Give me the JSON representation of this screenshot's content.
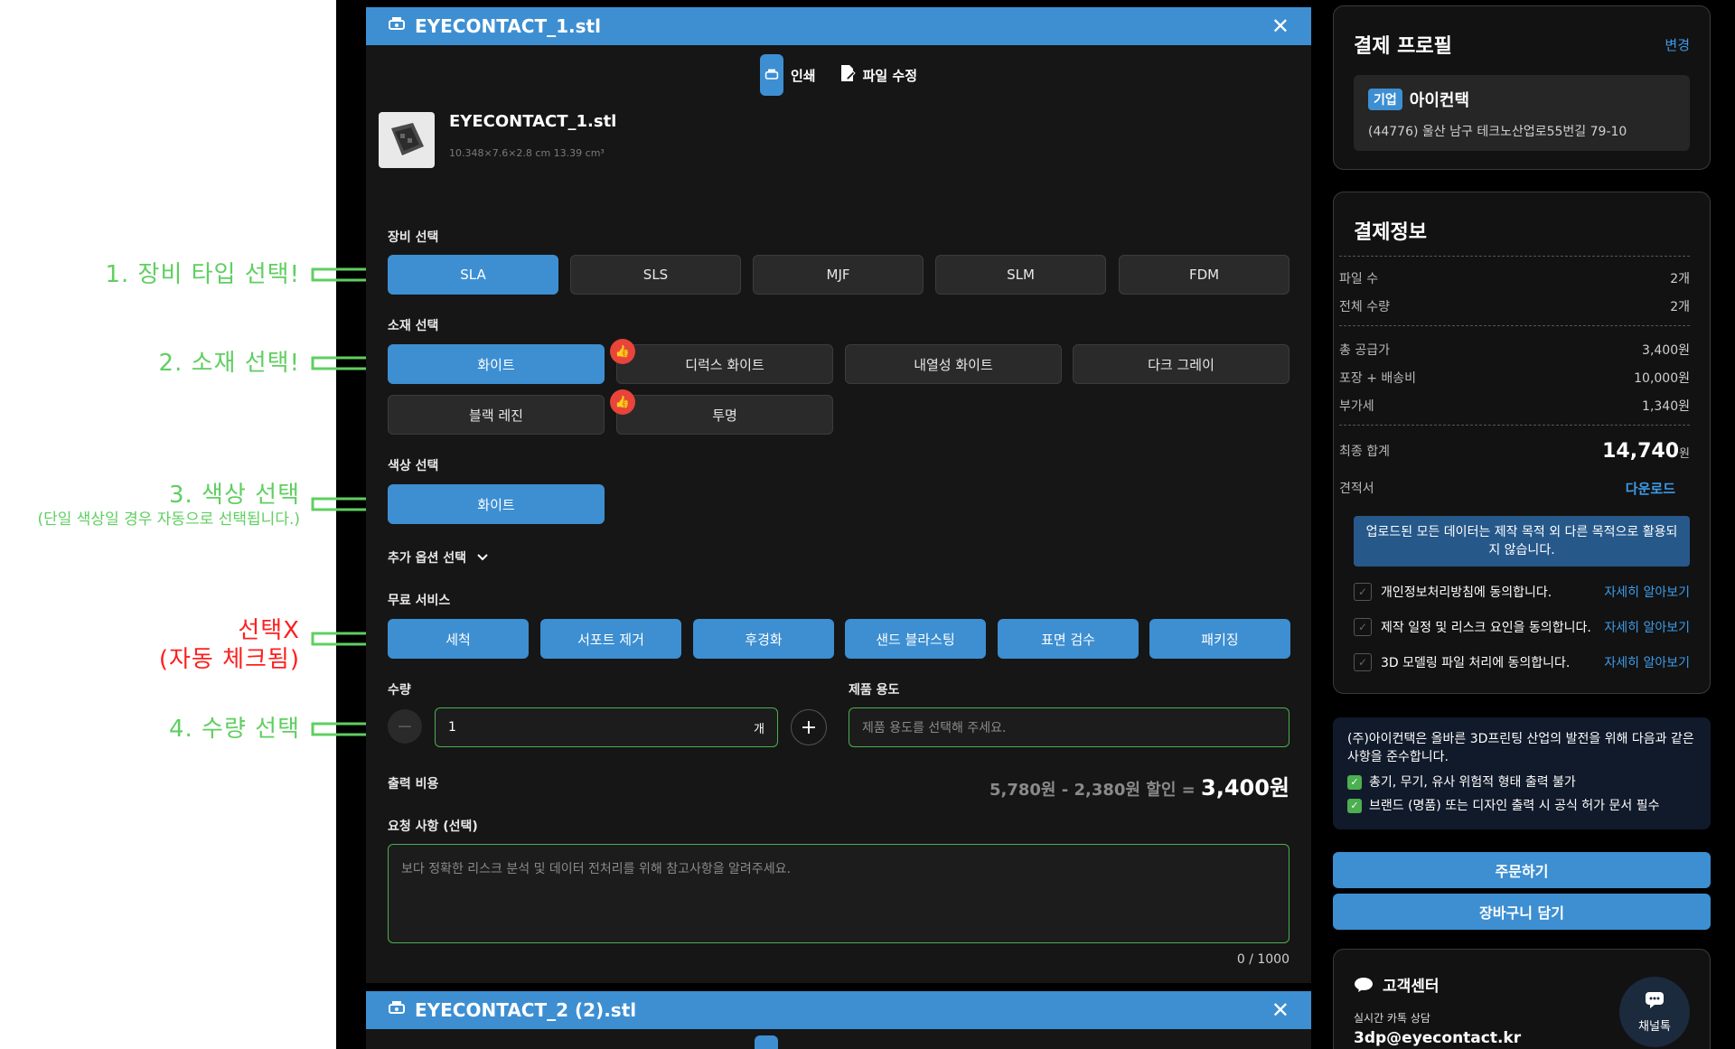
{
  "annotations": {
    "step1": "1. 장비 타입 선택!",
    "step2": "2. 소재 선택!",
    "step3": "3. 색상 선택",
    "step3_sub": "(단일 색상일 경우 자동으로 선택됩니다.)",
    "auto_line1": "선택X",
    "auto_line2": "(자동 체크됨)",
    "step4": "4. 수량 선택"
  },
  "colors": {
    "accent": "#3d8fd2",
    "annotation_green": "#5fcf60",
    "annotation_red": "#ff1e1e",
    "input_border": "#4caf50",
    "badge": "#e8443a"
  },
  "panel": {
    "title": "EYECONTACT_1.stl",
    "tabs": [
      {
        "label": "인쇄",
        "icon": "printer-icon"
      },
      {
        "label": "파일 수정",
        "icon": "edit-file-icon"
      }
    ],
    "file_name": "EYECONTACT_1.stl",
    "file_dims": "10.348×7.6×2.8 cm 13.39 cm³",
    "equipment": {
      "label": "장비 선택",
      "options": [
        "SLA",
        "SLS",
        "MJF",
        "SLM",
        "FDM"
      ],
      "selected": "SLA"
    },
    "material": {
      "label": "소재 선택",
      "options": [
        "화이트",
        "디럭스 화이트",
        "내열성 화이트",
        "다크 그레이",
        "블랙 레진",
        "투명"
      ],
      "selected": "화이트",
      "recommended": [
        "디럭스 화이트",
        "투명"
      ]
    },
    "color": {
      "label": "색상 선택",
      "options": [
        "화이트"
      ],
      "selected": "화이트"
    },
    "extra_options_label": "추가 옵션 선택",
    "free_service": {
      "label": "무료 서비스",
      "options": [
        "세척",
        "서포트 제거",
        "후경화",
        "샌드 블라스팅",
        "표면 검수",
        "패키징"
      ]
    },
    "quantity": {
      "label": "수량",
      "value": "1",
      "unit": "개"
    },
    "purpose": {
      "label": "제품 용도",
      "placeholder": "제품 용도를 선택해 주세요."
    },
    "cost": {
      "label": "출력 비용",
      "formula": "5,780원 - 2,380원 할인 = ",
      "total": "3,400원"
    },
    "request": {
      "label": "요청 사항 (선택)",
      "placeholder": "보다 정확한 리스크 분석 및 데이터 전처리를 위해 참고사항을 알려주세요.",
      "counter": "0 / 1000"
    }
  },
  "panel2": {
    "title": "EYECONTACT_2 (2).stl"
  },
  "profile": {
    "title": "결제 프로필",
    "change": "변경",
    "badge": "기업",
    "company": "아이컨택",
    "address": "(44776) 울산 남구 테크노산업로55번길 79-10"
  },
  "payment": {
    "title": "결제정보",
    "rows1": [
      {
        "k": "파일 수",
        "v": "2개"
      },
      {
        "k": "전체 수량",
        "v": "2개"
      }
    ],
    "rows2": [
      {
        "k": "총 공급가",
        "v": "3,400원"
      },
      {
        "k": "포장 + 배송비",
        "v": "10,000원"
      },
      {
        "k": "부가세",
        "v": "1,340원"
      }
    ],
    "final_label": "최종 합계",
    "final_value": "14,740",
    "final_unit": "원",
    "quote_label": "견적서",
    "quote_link": "다운로드",
    "notice": "업로드된 모든 데이터는 제작 목적 외 다른 목적으로 활용되지 않습니다.",
    "agreements": [
      {
        "text": "개인정보처리방침에 동의합니다.",
        "link": "자세히 알아보기"
      },
      {
        "text": "제작 일정 및 리스크 요인을 동의합니다.",
        "link": "자세히 알아보기"
      },
      {
        "text": "3D 모델링 파일 처리에 동의합니다.",
        "link": "자세히 알아보기"
      }
    ]
  },
  "compliance": {
    "intro": "(주)아이컨택은 올바른 3D프린팅 산업의 발전을 위해 다음과 같은 사항을 준수합니다.",
    "items": [
      "총기, 무기, 유사 위험적 형태 출력 불가",
      "브랜드 (명품) 또는 디자인 출력 시 공식 허가 문서 필수"
    ]
  },
  "actions": {
    "order": "주문하기",
    "cart": "장바구니 담기"
  },
  "support": {
    "title": "고객센터",
    "subtitle": "실시간 카톡 상담",
    "email": "3dp@eyecontact.kr",
    "chat_label": "채널톡"
  }
}
